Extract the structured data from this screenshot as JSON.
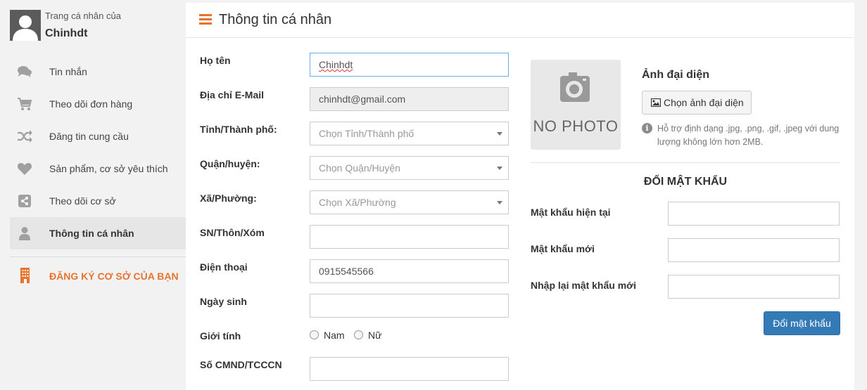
{
  "profile": {
    "caption": "Trang cá nhân của",
    "name": "Chinhdt"
  },
  "sidebar": {
    "items": [
      {
        "label": "Tin nhắn",
        "icon": "comments-icon",
        "active": false
      },
      {
        "label": "Theo dõi đơn hàng",
        "icon": "cart-icon",
        "active": false
      },
      {
        "label": "Đăng tin cung cầu",
        "icon": "shuffle-icon",
        "active": false
      },
      {
        "label": "Sản phẩm, cơ sở yêu thích",
        "icon": "heart-icon",
        "active": false
      },
      {
        "label": "Theo dõi cơ sở",
        "icon": "share-icon",
        "active": false
      },
      {
        "label": "Thông tin cá nhân",
        "icon": "user-icon",
        "active": true
      }
    ],
    "register_label": "ĐĂNG KÝ CƠ SỞ CỦA BẠN"
  },
  "header": {
    "title": "Thông tin cá nhân"
  },
  "form": {
    "fullname_label": "Họ tên",
    "fullname_value": "Chinhdt",
    "email_label": "Địa chỉ E-Mail",
    "email_value": "chinhdt@gmail.com",
    "province_label": "Tỉnh/Thành phố:",
    "province_placeholder": "Chọn Tỉnh/Thành phố",
    "district_label": "Quận/huyện:",
    "district_placeholder": "Chọn Quận/Huyện",
    "ward_label": "Xã/Phường:",
    "ward_placeholder": "Chọn Xã/Phường",
    "address_label": "SN/Thôn/Xóm",
    "address_value": "",
    "phone_label": "Điện thoại",
    "phone_value": "0915545566",
    "birthday_label": "Ngày sinh",
    "birthday_value": "",
    "gender_label": "Giới tính",
    "gender_male": "Nam",
    "gender_female": "Nữ",
    "idcard_label": "Số CMND/TCCCN",
    "idcard_value": ""
  },
  "avatar_section": {
    "photo_text": "NO PHOTO",
    "heading": "Ảnh đại diện",
    "choose_button": "Chọn ảnh đại diện",
    "hint": "Hỗ trợ định dạng .jpg, .png, .gif, .jpeg với dung lượng không lớn hơn 2MB."
  },
  "password_section": {
    "heading": "ĐỔI MẬT KHẨU",
    "current_label": "Mật khẩu hiện tại",
    "new_label": "Mật khẩu mới",
    "confirm_label": "Nhập lại mật khẩu mới",
    "submit_button": "Đổi mật khẩu"
  },
  "colors": {
    "accent": "#e8732f",
    "primary_button": "#337ab7",
    "sidebar_bg": "#f2f2f2"
  }
}
